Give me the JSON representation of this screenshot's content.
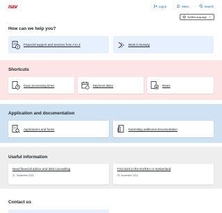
{
  "header": {
    "logo": "nav",
    "login_label": "Log in",
    "menu_label": "Menu",
    "search_label": "Search"
  },
  "language": {
    "selected": "Språk/Language"
  },
  "help": {
    "title": "How can we help you?",
    "cards": [
      {
        "label": "Financial support and services from A to Z",
        "icon": "document-money-icon"
      },
      {
        "label": "Work in Norway",
        "icon": "arrow-right-icon"
      }
    ]
  },
  "shortcuts": {
    "title": "Shortcuts",
    "items": [
      {
        "label": "Case processing times",
        "icon": "clock-document-icon"
      },
      {
        "label": "Payment dates",
        "icon": "calendar-icon"
      },
      {
        "label": "Rates",
        "icon": "bar-chart-document-icon"
      }
    ]
  },
  "application": {
    "title": "Application and documentation",
    "items": [
      {
        "label": "Applications and forms",
        "icon": "document-search-icon"
      },
      {
        "label": "Submitting additional documentation",
        "icon": "paperclip-icon"
      }
    ]
  },
  "useful": {
    "title": "Useful information",
    "items": [
      {
        "label": "Need financial advice and debt counselling",
        "date": "21. September 2022"
      },
      {
        "label": "Find work in the EU/EEA or Switzerland",
        "date": "20. November 2022"
      }
    ]
  },
  "contact": {
    "title": "Contact us"
  },
  "colors": {
    "brand_red": "#c30000",
    "link_blue": "#0067c5",
    "shortcuts_bg": "#fde5e5",
    "application_bg": "#cfe2f3",
    "useful_bg": "#eeeeee",
    "card_blue": "#e6f0ff"
  }
}
